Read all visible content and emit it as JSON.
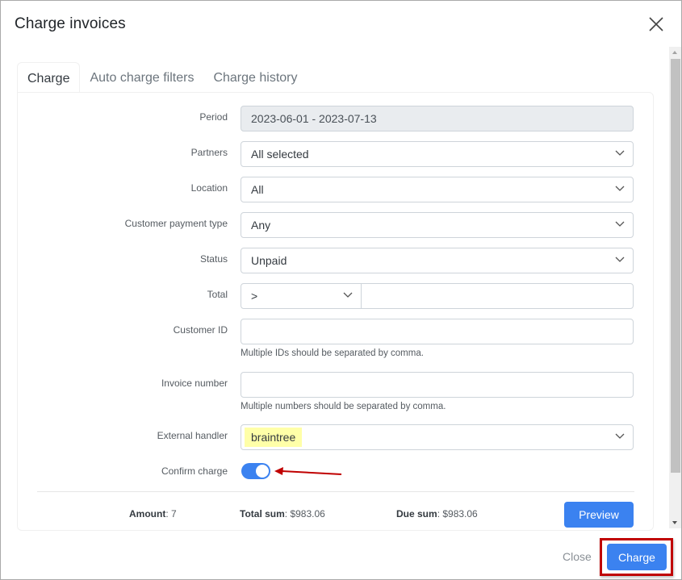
{
  "dialog": {
    "title": "Charge invoices",
    "close_icon": "close-x-icon"
  },
  "tabs": [
    {
      "label": "Charge",
      "active": true
    },
    {
      "label": "Auto charge filters",
      "active": false
    },
    {
      "label": "Charge history",
      "active": false
    }
  ],
  "form": {
    "period": {
      "label": "Period",
      "value": "2023-06-01 - 2023-07-13"
    },
    "partners": {
      "label": "Partners",
      "value": "All selected"
    },
    "location": {
      "label": "Location",
      "value": "All"
    },
    "customer_payment_type": {
      "label": "Customer payment type",
      "value": "Any"
    },
    "status": {
      "label": "Status",
      "value": "Unpaid"
    },
    "total": {
      "label": "Total",
      "operator": ">",
      "value": ""
    },
    "customer_id": {
      "label": "Customer ID",
      "value": "",
      "hint": "Multiple IDs should be separated by comma."
    },
    "invoice_number": {
      "label": "Invoice number",
      "value": "",
      "hint": "Multiple numbers should be separated by comma."
    },
    "external_handler": {
      "label": "External handler",
      "value": "braintree"
    },
    "confirm_charge": {
      "label": "Confirm charge",
      "enabled": true
    }
  },
  "summary": {
    "amount_label": "Amount",
    "amount_value": ": 7",
    "total_sum_label": "Total sum",
    "total_sum_value": ": $983.06",
    "due_sum_label": "Due sum",
    "due_sum_value": ": $983.06"
  },
  "buttons": {
    "preview": "Preview",
    "close": "Close",
    "charge": "Charge"
  },
  "colors": {
    "primary": "#3b82f0",
    "annotation": "#c00000",
    "highlight": "#ffffa8"
  }
}
